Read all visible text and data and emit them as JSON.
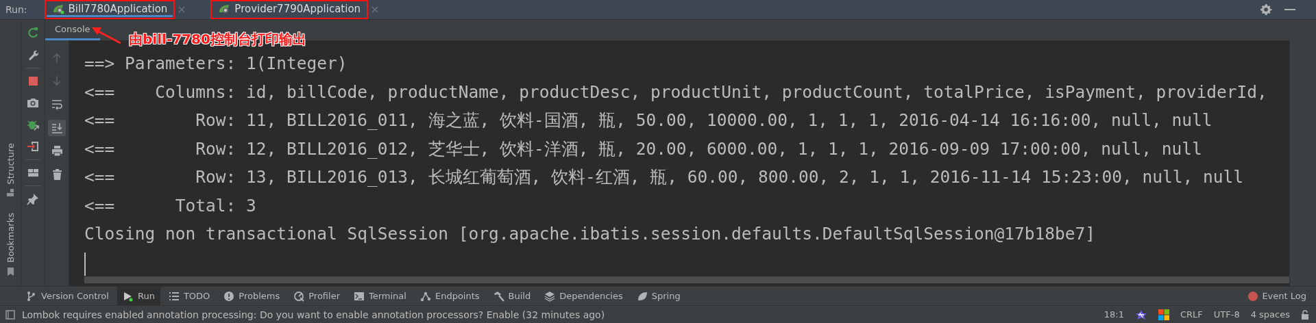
{
  "run_bar": {
    "label": "Run:",
    "tabs": [
      {
        "label": "Bill7780Application",
        "selected": true,
        "annotated": true
      },
      {
        "label": "Provider7790Application",
        "selected": false,
        "annotated": true
      }
    ]
  },
  "annotation": {
    "text": "由bill-7780控制台打印输出"
  },
  "console_tabs": [
    {
      "label": "Console",
      "selected": true
    }
  ],
  "side_labels": [
    {
      "label": "Structure",
      "kind": "structure"
    },
    {
      "label": "Bookmarks",
      "kind": "bookmark"
    }
  ],
  "console_lines": [
    "==> Parameters: 1(Integer)",
    "<==    Columns: id, billCode, productName, productDesc, productUnit, productCount, totalPrice, isPayment, providerId,",
    "<==        Row: 11, BILL2016_011, 海之蓝, 饮料-国酒, 瓶, 50.00, 10000.00, 1, 1, 1, 2016-04-14 16:16:00, null, null",
    "<==        Row: 12, BILL2016_012, 芝华士, 饮料-洋酒, 瓶, 20.00, 6000.00, 1, 1, 1, 2016-09-09 17:00:00, null, null",
    "<==        Row: 13, BILL2016_013, 长城红葡萄酒, 饮料-红酒, 瓶, 60.00, 800.00, 2, 1, 1, 2016-11-14 15:23:00, null, null",
    "<==      Total: 3",
    "Closing non transactional SqlSession [org.apache.ibatis.session.defaults.DefaultSqlSession@17b18be7]"
  ],
  "bottom_tools": [
    {
      "label": "Version Control",
      "kind": "vcs",
      "selected": false
    },
    {
      "label": "Run",
      "kind": "run",
      "selected": true
    },
    {
      "label": "TODO",
      "kind": "todo",
      "selected": false
    },
    {
      "label": "Problems",
      "kind": "problems",
      "selected": false
    },
    {
      "label": "Profiler",
      "kind": "profiler",
      "selected": false
    },
    {
      "label": "Terminal",
      "kind": "terminal",
      "selected": false
    },
    {
      "label": "Endpoints",
      "kind": "endpoints",
      "selected": false
    },
    {
      "label": "Build",
      "kind": "build",
      "selected": false
    },
    {
      "label": "Dependencies",
      "kind": "dependencies",
      "selected": false
    },
    {
      "label": "Spring",
      "kind": "spring",
      "selected": false
    }
  ],
  "event_log": {
    "label": "Event Log"
  },
  "status_bar": {
    "message": "Lombok requires enabled annotation processing: Do you want to enable annotation processors? Enable (32 minutes ago)",
    "position": "18:1",
    "line_ending": "CRLF",
    "encoding": "UTF-8",
    "indent": "4 spaces"
  }
}
